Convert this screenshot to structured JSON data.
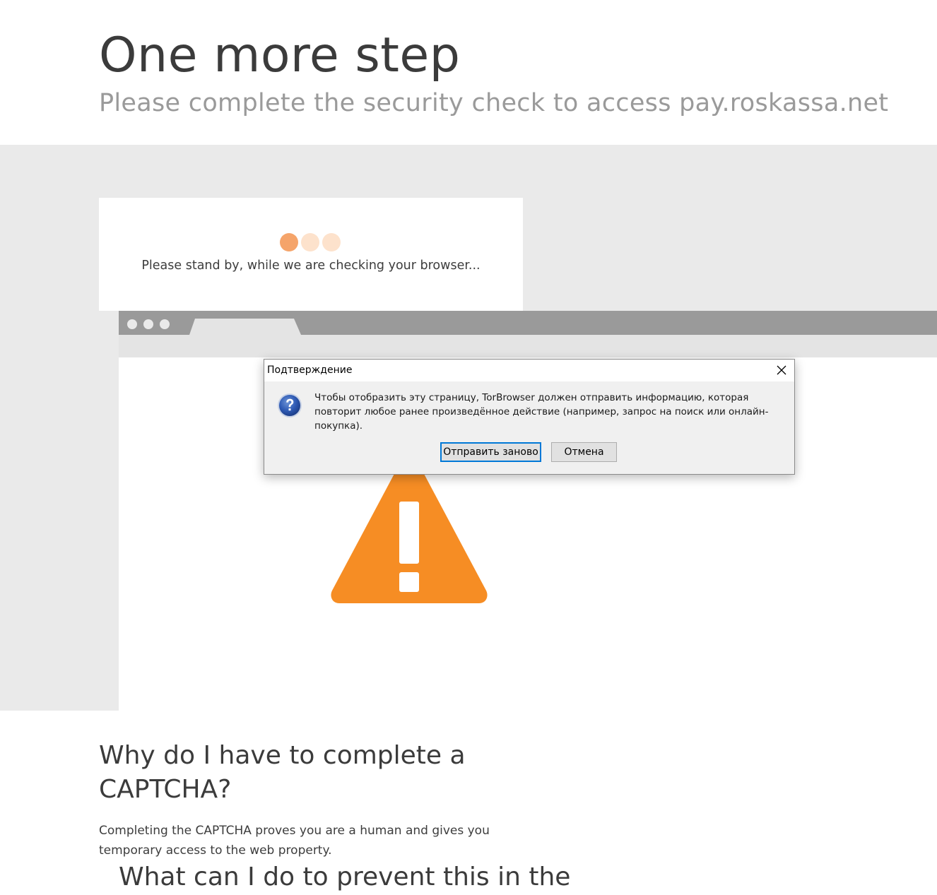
{
  "header": {
    "title": "One more step",
    "subtitle": "Please complete the security check to access pay.roskassa.net"
  },
  "check": {
    "status": "Please stand by, while we are checking your browser..."
  },
  "dialog": {
    "title": "Подтверждение",
    "message": "Чтобы отобразить эту страницу, TorBrowser должен отправить информацию, которая повторит любое ранее произведённое действие (например, запрос на поиск или онлайн-покупка).",
    "resend_label": "Отправить заново",
    "cancel_label": "Отмена",
    "icon": "question-icon"
  },
  "faq": {
    "q1": "Why do I have to complete a CAPTCHA?",
    "a1": "Completing the CAPTCHA proves you are a human and gives you temporary access to the web property.",
    "q2": "What can I do to prevent this in the"
  },
  "colors": {
    "warning": "#f68d24",
    "loader_active": "#f5a46a",
    "loader_idle": "#fde2cc",
    "dialog_focus": "#0078d7"
  }
}
